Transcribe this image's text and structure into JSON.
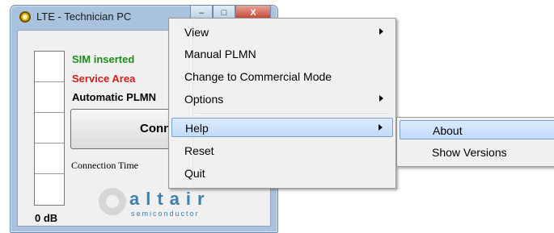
{
  "window": {
    "title": "LTE - Technician PC",
    "controls": {
      "minimize": "–",
      "maximize": "□",
      "close": "X"
    }
  },
  "status": {
    "sim": "SIM inserted",
    "service": "Service Area",
    "plmn": "Automatic PLMN",
    "signal_db": "0 dB",
    "colors": {
      "ok": "#1e8c1e",
      "warn": "#d31c1c"
    }
  },
  "main": {
    "connect_label": "Connect",
    "connection_time_label": "Connection Time"
  },
  "logo": {
    "word": "altair",
    "sub": "semiconductor"
  },
  "context_menu": {
    "items": [
      {
        "label": "View",
        "has_submenu": true
      },
      {
        "label": "Manual PLMN",
        "has_submenu": false
      },
      {
        "label": "Change to Commercial Mode",
        "has_submenu": false
      },
      {
        "label": "Options",
        "has_submenu": true
      },
      {
        "label": "Help",
        "has_submenu": true,
        "highlighted": true
      },
      {
        "label": "Reset",
        "has_submenu": false
      },
      {
        "label": "Quit",
        "has_submenu": false
      }
    ]
  },
  "help_submenu": {
    "items": [
      {
        "label": "About",
        "highlighted": true
      },
      {
        "label": "Show Versions"
      }
    ]
  }
}
